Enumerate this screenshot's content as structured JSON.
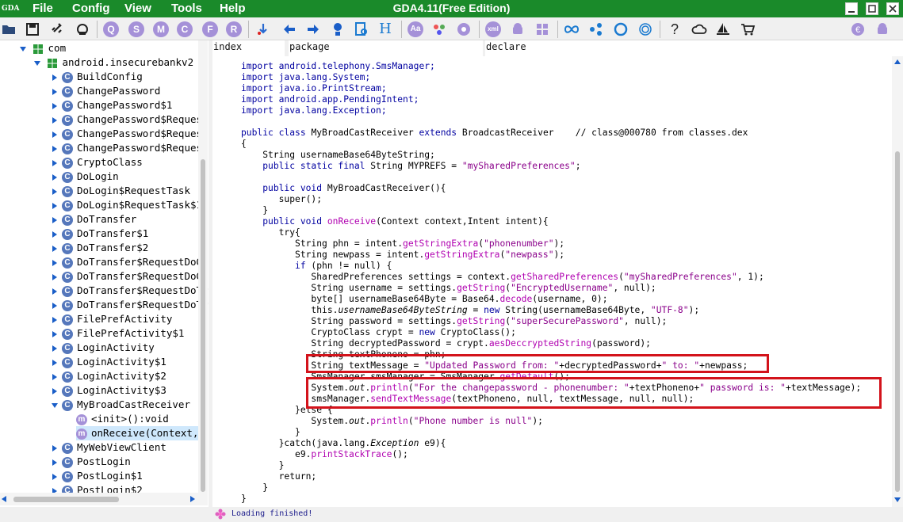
{
  "app": {
    "title": "GDA4.11(Free Edition)",
    "logo_text": "GDA"
  },
  "menu": [
    "File",
    "Config",
    "View",
    "Tools",
    "Help"
  ],
  "toolbar": {
    "circle_letters": [
      "Q",
      "S",
      "M",
      "C",
      "F",
      "R"
    ],
    "h_label": "H",
    "aa_label": "Aa",
    "xml_label": "xml"
  },
  "tree": {
    "root": "com",
    "package": "android.insecurebankv2",
    "class_icon_letter": "C",
    "method_icon_letter": "m",
    "items": [
      "BuildConfig",
      "ChangePassword",
      "ChangePassword$1",
      "ChangePassword$Request",
      "ChangePassword$Reques",
      "ChangePassword$Request",
      "CryptoClass",
      "DoLogin",
      "DoLogin$RequestTask",
      "DoLogin$RequestTask$1",
      "DoTransfer",
      "DoTransfer$1",
      "DoTransfer$2",
      "DoTransfer$RequestDoGe",
      "DoTransfer$RequestDoGe",
      "DoTransfer$RequestDoTr",
      "DoTransfer$RequestDoTr",
      "FilePrefActivity",
      "FilePrefActivity$1",
      "LoginActivity",
      "LoginActivity$1",
      "LoginActivity$2",
      "LoginActivity$3",
      "MyBroadCastReceiver"
    ],
    "methods": [
      "<init>():void",
      "onReceive(Context,I"
    ],
    "items_after": [
      "MyWebViewClient",
      "PostLogin",
      "PostLogin$1",
      "PostLogin$2"
    ]
  },
  "tabs": [
    "index",
    "package",
    "declare"
  ],
  "code": {
    "imports": [
      "import android.telephony.SmsManager;",
      "import java.lang.System;",
      "import java.io.PrintStream;",
      "import android.app.PendingIntent;",
      "import java.lang.Exception;"
    ],
    "class_decl": {
      "public": "public",
      "class": "class",
      "name": "MyBroadCastReceiver",
      "extends": "extends",
      "super": "BroadcastReceiver",
      "comment": "// class@000780 from classes.dex"
    }
  },
  "status": {
    "text": "Loading finished!"
  },
  "colors": {
    "titlebar": "#1a8a2a",
    "highlight": "#d3131b",
    "keyword": "#0000a0",
    "string": "#8a008a",
    "method": "#b000b0"
  }
}
